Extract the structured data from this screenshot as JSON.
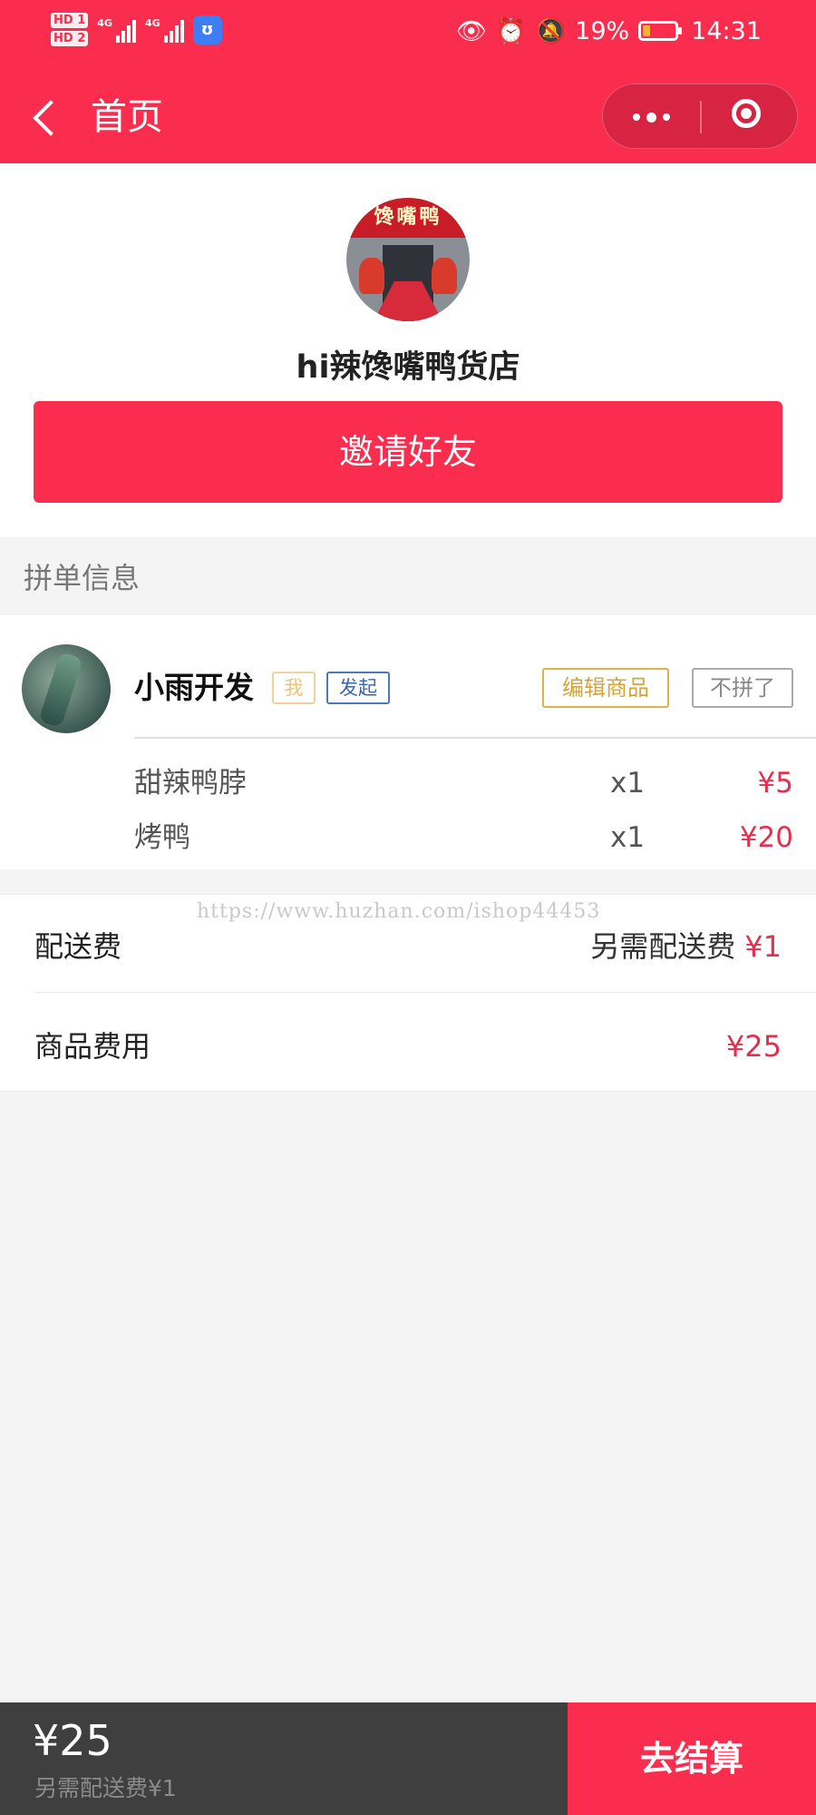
{
  "status_bar": {
    "hd1": "HD 1",
    "hd2": "HD 2",
    "network1": "4G",
    "network2": "4G",
    "battery_percent": "19%",
    "time": "14:31",
    "icons": [
      "eye-icon",
      "alarm-icon",
      "mute-bell-icon",
      "battery-icon"
    ]
  },
  "nav": {
    "title": "首页"
  },
  "store": {
    "sign_text": "馋嘴鸭",
    "name": "hi辣馋嘴鸭货店",
    "invite_label": "邀请好友"
  },
  "section": {
    "title": "拼单信息"
  },
  "member": {
    "name": "小雨开发",
    "tag_me": "我",
    "tag_initiator": "发起",
    "edit_label": "编辑商品",
    "quit_label": "不拼了",
    "items": [
      {
        "name": "甜辣鸭脖",
        "qty": "x1",
        "price": "¥5"
      },
      {
        "name": "烤鸭",
        "qty": "x1",
        "price": "¥20"
      }
    ]
  },
  "fees": {
    "watermark": "https://www.huzhan.com/ishop44453",
    "delivery_label": "配送费",
    "delivery_note": "另需配送费",
    "delivery_value": "¥1",
    "goods_label": "商品费用",
    "goods_value": "¥25"
  },
  "bottom": {
    "total": "¥25",
    "note": "另需配送费¥1",
    "checkout_label": "去结算"
  },
  "colors": {
    "brand": "#fa2d4f",
    "price": "#e2304e",
    "bottom_bar": "#3f3f3f"
  }
}
